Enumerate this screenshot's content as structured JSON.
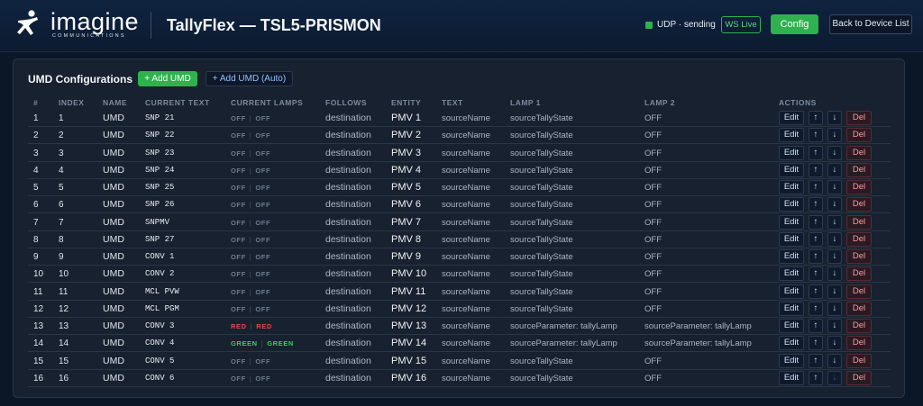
{
  "header": {
    "logo_word": "imagine",
    "logo_sub": "COMMUNICATIONS",
    "app_title": "TallyFlex — TSL5-PRISMON",
    "udp_status": "UDP · sending",
    "ws_status": "WS Live",
    "config_label": "Config",
    "back_label": "Back to Device List"
  },
  "panel": {
    "title": "UMD Configurations",
    "add_label": "+ Add UMD",
    "add_auto_label": "+ Add UMD (Auto)"
  },
  "columns": [
    "#",
    "INDEX",
    "NAME",
    "CURRENT TEXT",
    "CURRENT LAMPS",
    "FOLLOWS",
    "ENTITY",
    "TEXT",
    "LAMP 1",
    "LAMP 2",
    "ACTIONS"
  ],
  "actions": {
    "edit": "Edit",
    "up": "↑",
    "down": "↓",
    "del": "Del"
  },
  "colors": {
    "green": "#2fb24e",
    "red_lamp": "#e24b4b",
    "green_lamp": "#3ccf5e",
    "off_lamp": "#6f7b8f"
  },
  "rows": [
    {
      "num": "1",
      "index": "1",
      "name": "UMD",
      "current_text": "SNP 21",
      "lamp_left": "OFF",
      "lamp_right": "OFF",
      "follows": "destination",
      "entity": "PMV 1",
      "text": "sourceName",
      "lamp1": "sourceTallyState",
      "lamp2": "OFF"
    },
    {
      "num": "2",
      "index": "2",
      "name": "UMD",
      "current_text": "SNP 22",
      "lamp_left": "OFF",
      "lamp_right": "OFF",
      "follows": "destination",
      "entity": "PMV 2",
      "text": "sourceName",
      "lamp1": "sourceTallyState",
      "lamp2": "OFF"
    },
    {
      "num": "3",
      "index": "3",
      "name": "UMD",
      "current_text": "SNP 23",
      "lamp_left": "OFF",
      "lamp_right": "OFF",
      "follows": "destination",
      "entity": "PMV 3",
      "text": "sourceName",
      "lamp1": "sourceTallyState",
      "lamp2": "OFF"
    },
    {
      "num": "4",
      "index": "4",
      "name": "UMD",
      "current_text": "SNP 24",
      "lamp_left": "OFF",
      "lamp_right": "OFF",
      "follows": "destination",
      "entity": "PMV 4",
      "text": "sourceName",
      "lamp1": "sourceTallyState",
      "lamp2": "OFF"
    },
    {
      "num": "5",
      "index": "5",
      "name": "UMD",
      "current_text": "SNP 25",
      "lamp_left": "OFF",
      "lamp_right": "OFF",
      "follows": "destination",
      "entity": "PMV 5",
      "text": "sourceName",
      "lamp1": "sourceTallyState",
      "lamp2": "OFF"
    },
    {
      "num": "6",
      "index": "6",
      "name": "UMD",
      "current_text": "SNP 26",
      "lamp_left": "OFF",
      "lamp_right": "OFF",
      "follows": "destination",
      "entity": "PMV 6",
      "text": "sourceName",
      "lamp1": "sourceTallyState",
      "lamp2": "OFF"
    },
    {
      "num": "7",
      "index": "7",
      "name": "UMD",
      "current_text": "SNPMV",
      "lamp_left": "OFF",
      "lamp_right": "OFF",
      "follows": "destination",
      "entity": "PMV 7",
      "text": "sourceName",
      "lamp1": "sourceTallyState",
      "lamp2": "OFF"
    },
    {
      "num": "8",
      "index": "8",
      "name": "UMD",
      "current_text": "SNP 27",
      "lamp_left": "OFF",
      "lamp_right": "OFF",
      "follows": "destination",
      "entity": "PMV 8",
      "text": "sourceName",
      "lamp1": "sourceTallyState",
      "lamp2": "OFF"
    },
    {
      "num": "9",
      "index": "9",
      "name": "UMD",
      "current_text": "CONV 1",
      "lamp_left": "OFF",
      "lamp_right": "OFF",
      "follows": "destination",
      "entity": "PMV 9",
      "text": "sourceName",
      "lamp1": "sourceTallyState",
      "lamp2": "OFF"
    },
    {
      "num": "10",
      "index": "10",
      "name": "UMD",
      "current_text": "CONV 2",
      "lamp_left": "OFF",
      "lamp_right": "OFF",
      "follows": "destination",
      "entity": "PMV 10",
      "text": "sourceName",
      "lamp1": "sourceTallyState",
      "lamp2": "OFF"
    },
    {
      "num": "11",
      "index": "11",
      "name": "UMD",
      "current_text": "MCL PVW",
      "lamp_left": "OFF",
      "lamp_right": "OFF",
      "follows": "destination",
      "entity": "PMV 11",
      "text": "sourceName",
      "lamp1": "sourceTallyState",
      "lamp2": "OFF"
    },
    {
      "num": "12",
      "index": "12",
      "name": "UMD",
      "current_text": "MCL PGM",
      "lamp_left": "OFF",
      "lamp_right": "OFF",
      "follows": "destination",
      "entity": "PMV 12",
      "text": "sourceName",
      "lamp1": "sourceTallyState",
      "lamp2": "OFF"
    },
    {
      "num": "13",
      "index": "13",
      "name": "UMD",
      "current_text": "CONV 3",
      "lamp_left": "RED",
      "lamp_right": "RED",
      "follows": "destination",
      "entity": "PMV 13",
      "text": "sourceName",
      "lamp1": "sourceParameter: tallyLamp",
      "lamp2": "sourceParameter: tallyLamp"
    },
    {
      "num": "14",
      "index": "14",
      "name": "UMD",
      "current_text": "CONV 4",
      "lamp_left": "GREEN",
      "lamp_right": "GREEN",
      "follows": "destination",
      "entity": "PMV 14",
      "text": "sourceName",
      "lamp1": "sourceParameter: tallyLamp",
      "lamp2": "sourceParameter: tallyLamp"
    },
    {
      "num": "15",
      "index": "15",
      "name": "UMD",
      "current_text": "CONV 5",
      "lamp_left": "OFF",
      "lamp_right": "OFF",
      "follows": "destination",
      "entity": "PMV 15",
      "text": "sourceName",
      "lamp1": "sourceTallyState",
      "lamp2": "OFF"
    },
    {
      "num": "16",
      "index": "16",
      "name": "UMD",
      "current_text": "CONV 6",
      "lamp_left": "OFF",
      "lamp_right": "OFF",
      "follows": "destination",
      "entity": "PMV 16",
      "text": "sourceName",
      "lamp1": "sourceTallyState",
      "lamp2": "OFF"
    }
  ]
}
